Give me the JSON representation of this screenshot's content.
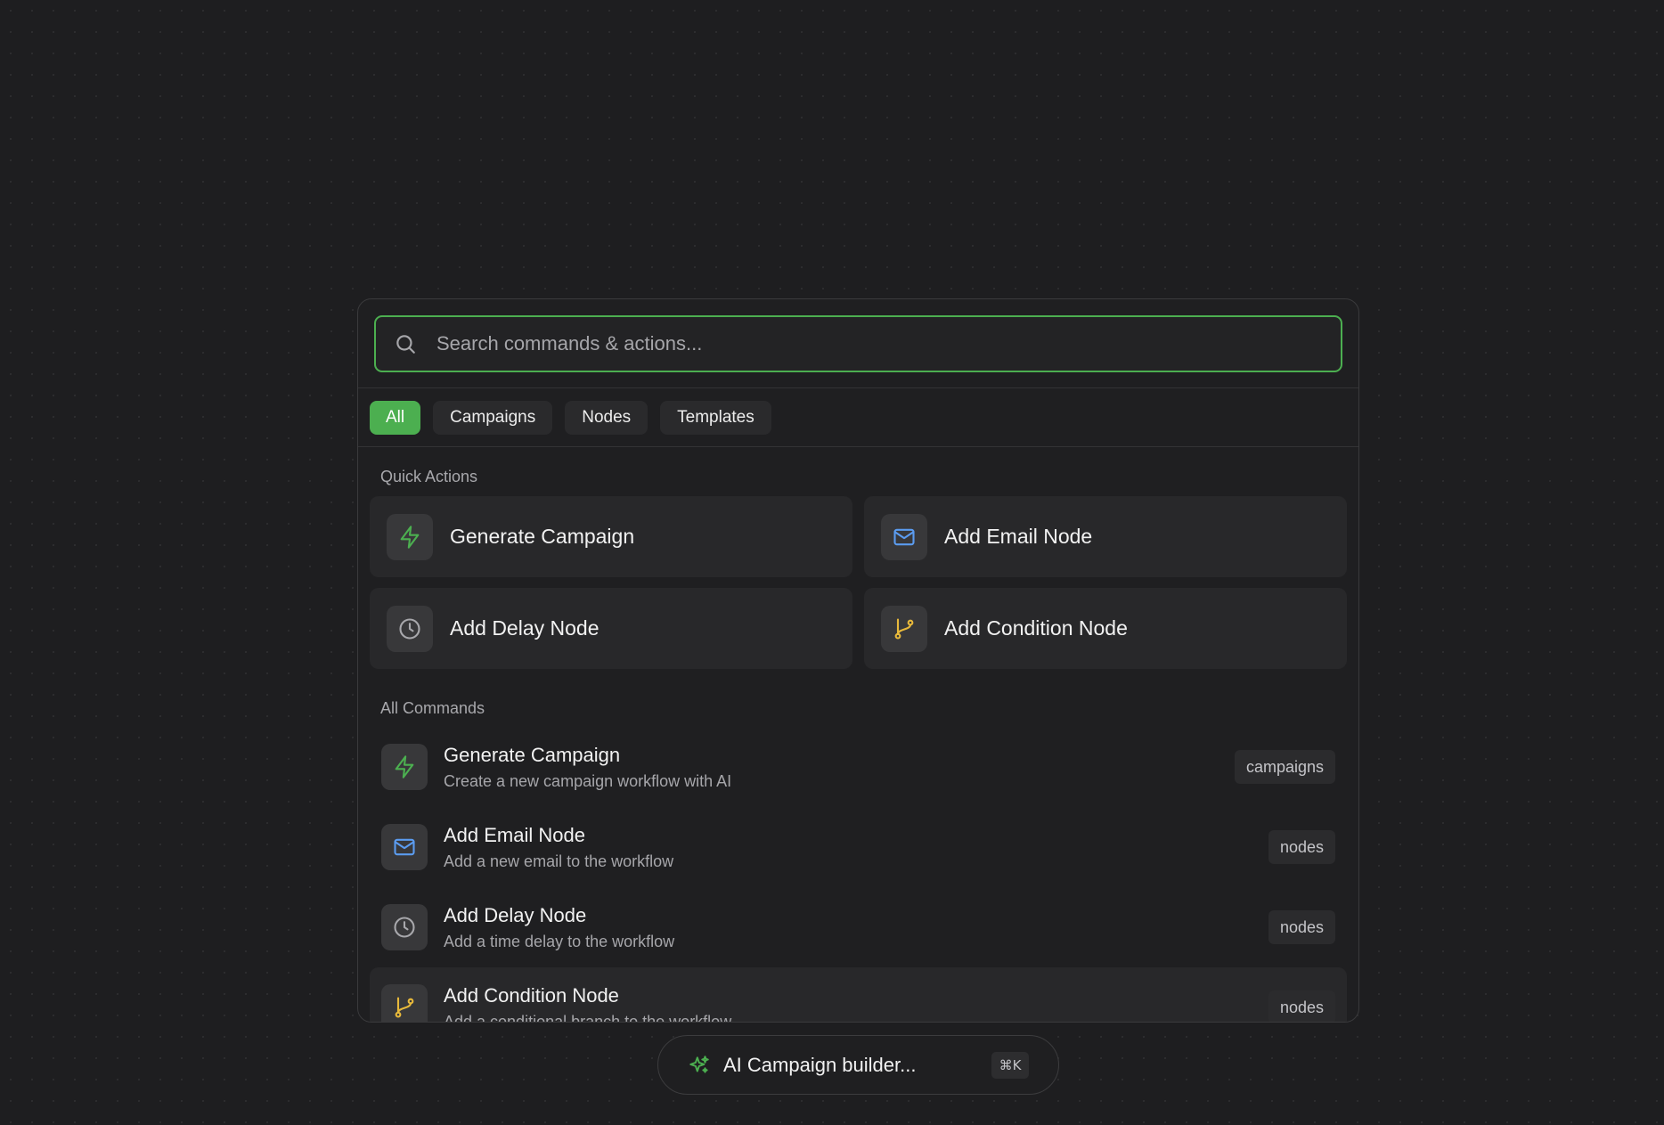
{
  "search": {
    "placeholder": "Search commands & actions..."
  },
  "tabs": [
    {
      "label": "All",
      "active": true
    },
    {
      "label": "Campaigns"
    },
    {
      "label": "Nodes"
    },
    {
      "label": "Templates"
    }
  ],
  "quick_actions": {
    "label": "Quick Actions",
    "items": [
      {
        "title": "Generate Campaign",
        "icon": "lightning-icon"
      },
      {
        "title": "Add Email Node",
        "icon": "mail-icon"
      },
      {
        "title": "Add Delay Node",
        "icon": "clock-icon"
      },
      {
        "title": "Add Condition Node",
        "icon": "branch-icon"
      }
    ]
  },
  "all_commands": {
    "label": "All Commands",
    "items": [
      {
        "title": "Generate Campaign",
        "desc": "Create a new campaign workflow with AI",
        "tag": "campaigns",
        "icon": "lightning-icon"
      },
      {
        "title": "Add Email Node",
        "desc": "Add a new email to the workflow",
        "tag": "nodes",
        "icon": "mail-icon"
      },
      {
        "title": "Add Delay Node",
        "desc": "Add a time delay to the workflow",
        "tag": "nodes",
        "icon": "clock-icon"
      },
      {
        "title": "Add Condition Node",
        "desc": "Add a conditional branch to the workflow",
        "tag": "nodes",
        "icon": "branch-icon"
      }
    ]
  },
  "builder": {
    "label": "AI Campaign builder...",
    "shortcut": "⌘K",
    "icon": "sparkles-icon"
  },
  "colors": {
    "accent": "#4caf50",
    "mail": "#5b9cf0",
    "clock": "#a8a8ac",
    "branch": "#e8b93b"
  }
}
